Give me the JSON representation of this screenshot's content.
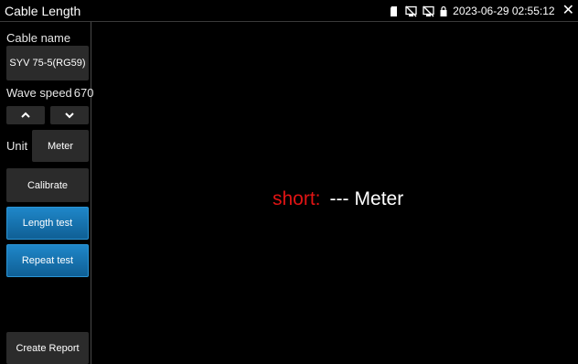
{
  "window": {
    "title": "Cable Length",
    "datetime": "2023-06-29 02:55:12"
  },
  "status_icons": [
    "sd-card-icon",
    "no-network-icon",
    "no-network-icon",
    "lock-icon"
  ],
  "sidebar": {
    "cable_name_label": "Cable name",
    "cable_name_value": "SYV 75-5(RG59)",
    "wave_speed_label": "Wave speed",
    "wave_speed_value": "670",
    "unit_label": "Unit",
    "unit_value": "Meter",
    "calibrate_label": "Calibrate",
    "length_test_label": "Length test",
    "repeat_test_label": "Repeat test",
    "create_report_label": "Create Report"
  },
  "result": {
    "key": "short:",
    "value": "---",
    "unit": "Meter"
  },
  "colors": {
    "background": "#000000",
    "accent_blue": "#1a78b8",
    "short_red": "#e01414"
  }
}
